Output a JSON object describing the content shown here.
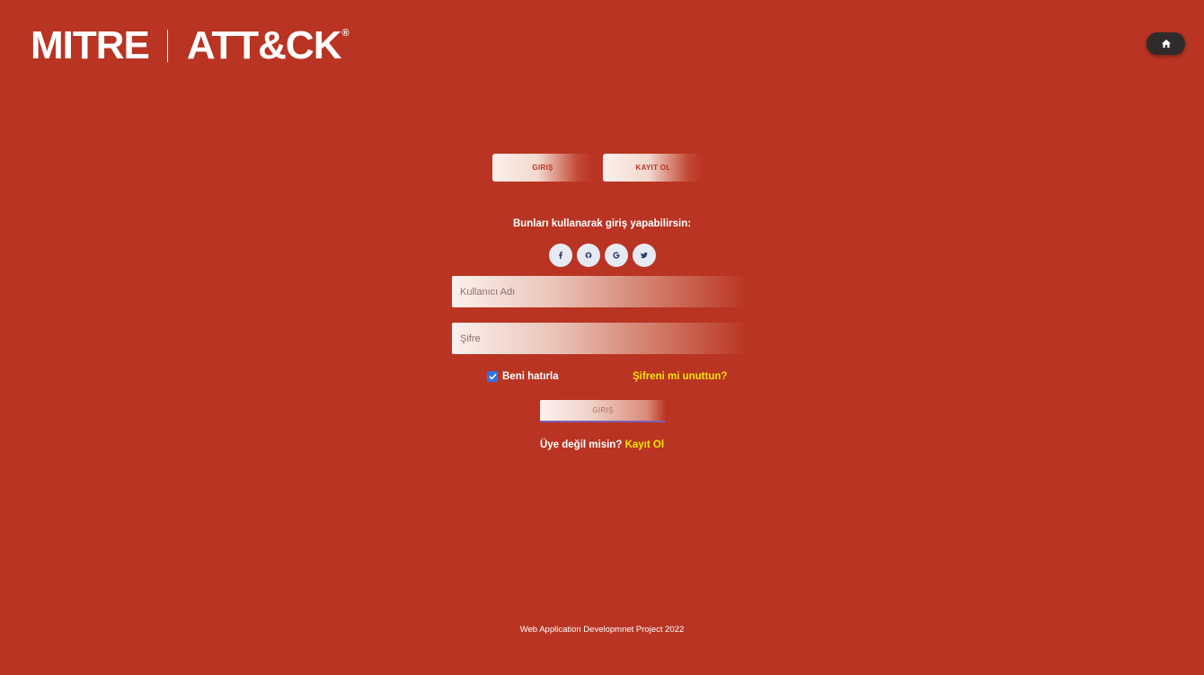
{
  "header": {
    "logo_left": "MITRE",
    "logo_right": "ATT&CK",
    "logo_reg": "®",
    "home_icon": "home-icon"
  },
  "tabs": {
    "login_label": "GIRIŞ",
    "register_label": "KAYIT OL"
  },
  "social": {
    "title": "Bunları kullanarak giriş yapabilirsin:",
    "icons": [
      "facebook-icon",
      "github-icon",
      "google-icon",
      "twitter-icon"
    ]
  },
  "form": {
    "username_placeholder": "Kullanıcı Adı",
    "password_placeholder": "Şifre",
    "remember_label": "Beni hatırla",
    "remember_checked": true,
    "forgot_label": "Şifreni mi unuttun?",
    "submit_label": "GIRIŞ",
    "signup_prompt": "Üye değil misin?",
    "signup_link": "Kayıt Ol"
  },
  "footer": {
    "text": "Web Application Developmnet Project 2022"
  },
  "colors": {
    "background": "#b93422",
    "link_yellow": "#f2e300",
    "home_button": "#2f2b2b",
    "checkbox": "#2f74e6"
  }
}
